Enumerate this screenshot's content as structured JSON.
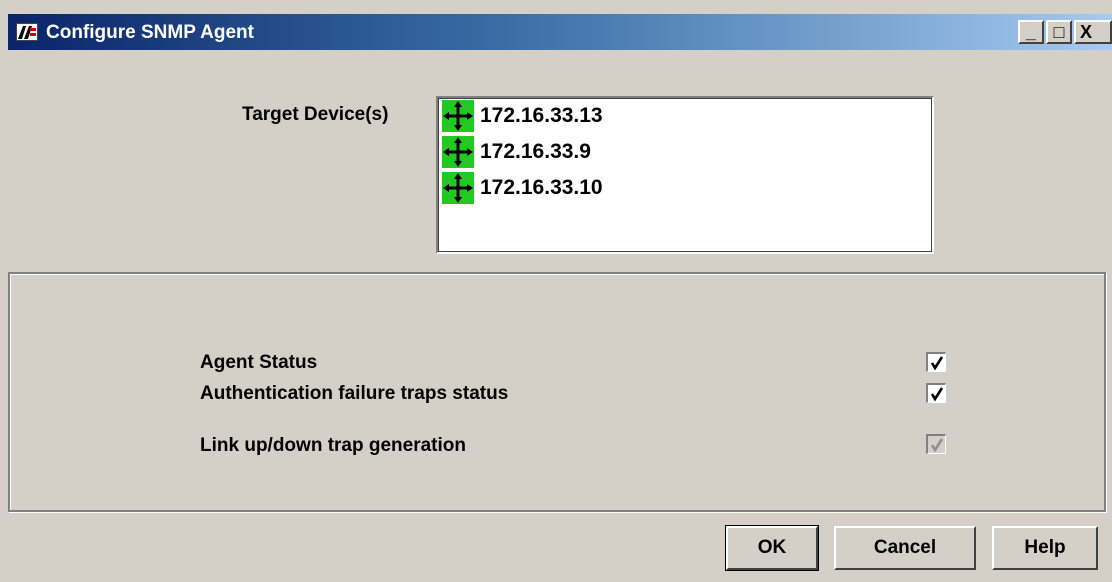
{
  "window": {
    "title": "Configure SNMP Agent",
    "controls": {
      "minimize": "_",
      "maximize": "□",
      "close": "X"
    }
  },
  "target": {
    "label": "Target Device(s)",
    "devices": [
      "172.16.33.13",
      "172.16.33.9",
      "172.16.33.10"
    ]
  },
  "options": [
    {
      "label": "Agent Status",
      "checked": true,
      "enabled": true
    },
    {
      "label": "Authentication failure traps status",
      "checked": true,
      "enabled": true
    },
    {
      "label": "Link up/down trap generation",
      "checked": true,
      "enabled": false
    }
  ],
  "buttons": {
    "ok": "OK",
    "cancel": "Cancel",
    "help": "Help"
  },
  "icons": {
    "app": "app-logo-icon",
    "device": "network-device-icon",
    "check": "checkmark-icon"
  },
  "colors": {
    "title_gradient_start": "#0a246a",
    "title_gradient_end": "#a6caf0",
    "device_icon_bg": "#22c922",
    "window_bg": "#d4d0c8"
  }
}
